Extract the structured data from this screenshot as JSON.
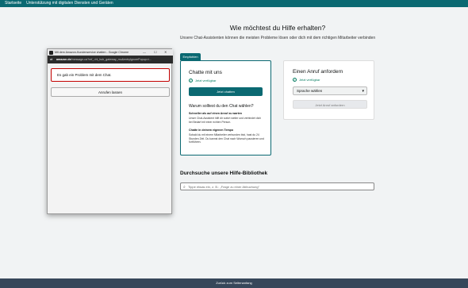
{
  "topnav": {
    "items": [
      "Startseite",
      "Unterstützung mit digitalen Diensten und Geräten"
    ]
  },
  "main": {
    "heading": "Wie möchtest du Hilfe erhalten?",
    "subheading": "Unsere Chat-Assistenten können die meisten Probleme lösen oder dich mit dem richtigen Mitarbeiter verbinden"
  },
  "chat_card": {
    "badge": "Empfohlen",
    "title": "Chatte mit uns",
    "availability": "Jetzt verfügbar",
    "button": "Jetzt chatten",
    "why_title": "Warum solltest du den Chat wählen?",
    "points": [
      {
        "title": "Schneller als auf einen Anruf zu warten",
        "text": "Unser Chat-Assistent hilft dir sofort weiter und verbindet dich bei Bedarf mit einer echten Person."
      },
      {
        "title": "Chatte in deinem eigenen Tempo",
        "text": "Sobald du mit einem Mitarbeiter verbunden bist, hast du 24 Stunden Zeit. Du kannst den Chat nach Wunsch pausieren und fortführen."
      }
    ]
  },
  "call_card": {
    "title": "Einen Anruf anfordern",
    "availability": "Jetzt verfügbar",
    "language_select": "Sprache wählen",
    "button": "Jetzt Anruf anfordern"
  },
  "library": {
    "title": "Durchsuche unsere Hilfe-Bibliothek",
    "placeholder": "Tippe etwas ein, z. B.: „Frage zu einer Abbuchung\""
  },
  "popup": {
    "title": "Mit dem Amazon-Kundenservice chatten - Google Chrome",
    "url_domain": "amazon.de",
    "url_path": "/message-us?ref_=hl_hub_gateway_mu&entryIgnorePopup=t...",
    "error_text": "Es gab ein Problem mit dem Chat.",
    "call_button": "Anrufen lassen"
  },
  "footer": {
    "back_to_top": "Zurück zum Seitenanfang"
  },
  "colors": {
    "brand_teal": "#0b6972",
    "error_red": "#c40000",
    "available_green": "#067d62",
    "footer_bg": "#37475a"
  }
}
